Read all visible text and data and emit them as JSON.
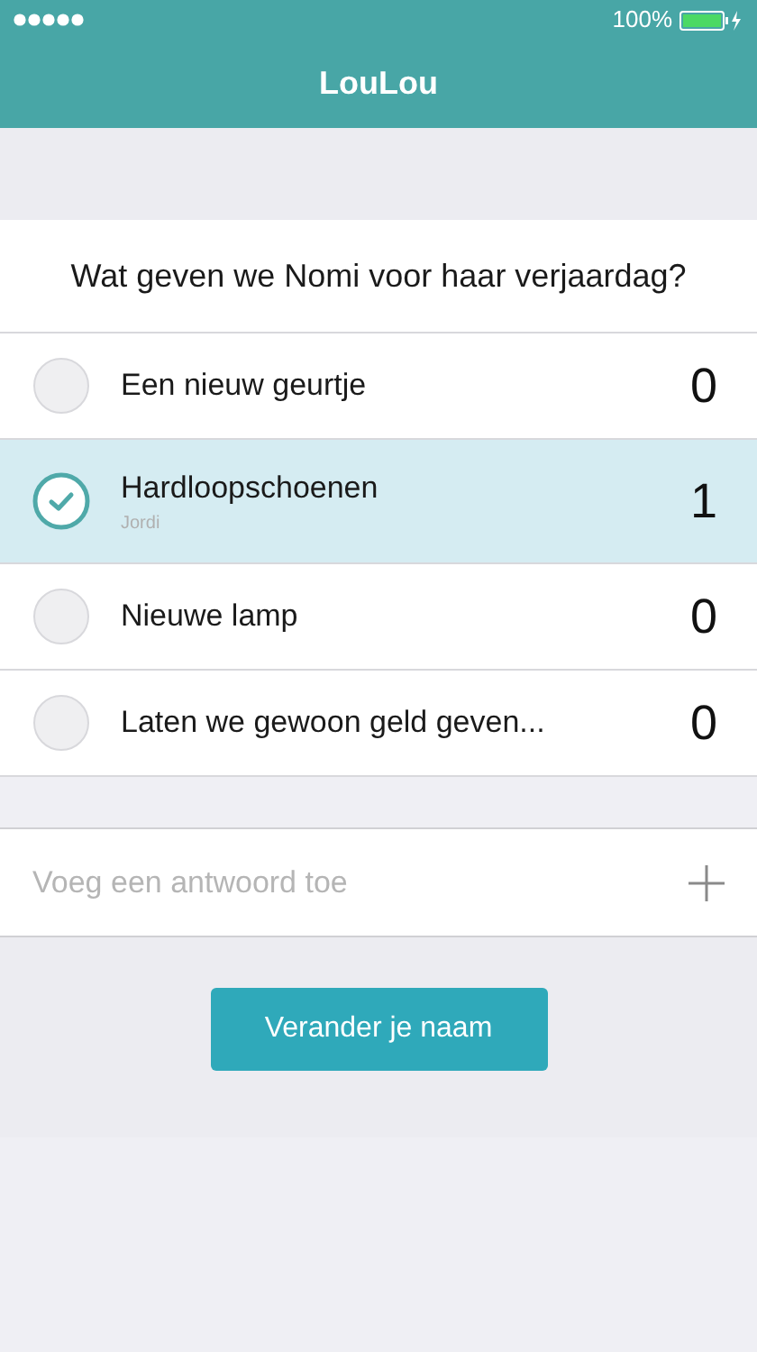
{
  "status_bar": {
    "battery": "100%"
  },
  "nav": {
    "title": "LouLou"
  },
  "question": "Wat geven we Nomi voor haar verjaardag?",
  "options": [
    {
      "label": "Een nieuw geurtje",
      "count": "0",
      "selected": false
    },
    {
      "label": "Hardloopschoenen",
      "voters": "Jordi",
      "count": "1",
      "selected": true
    },
    {
      "label": "Nieuwe lamp",
      "count": "0",
      "selected": false
    },
    {
      "label": "Laten we gewoon geld geven...",
      "count": "0",
      "selected": false
    }
  ],
  "add_answer": {
    "placeholder": "Voeg een antwoord toe"
  },
  "button": "Verander je naam"
}
